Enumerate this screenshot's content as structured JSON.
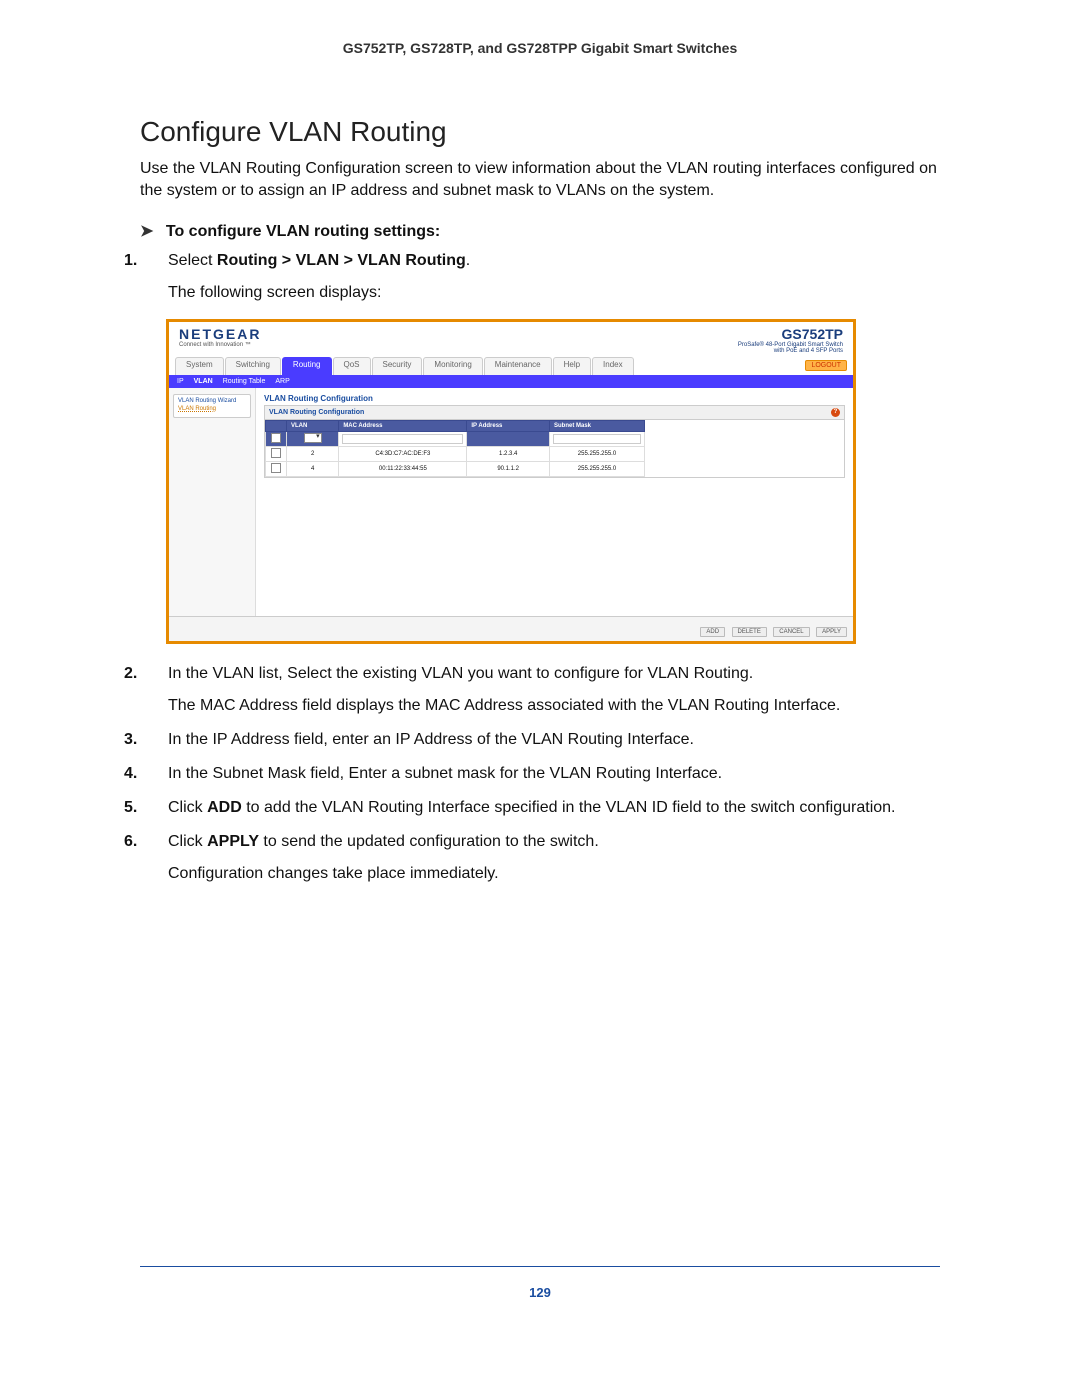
{
  "header": "GS752TP, GS728TP, and GS728TPP Gigabit Smart Switches",
  "section_title": "Configure VLAN Routing",
  "intro": "Use the VLAN Routing Configuration screen to view information about the VLAN routing interfaces configured on the system or to assign an IP address and subnet mask to VLANs on the system.",
  "procedure_heading": "To configure VLAN routing settings:",
  "steps": {
    "s1_prefix": "Select ",
    "s1_bold": "Routing > VLAN > VLAN Routing",
    "s1_suffix": ".",
    "s1_sub": "The following screen displays:",
    "s2": "In the VLAN list, Select the existing VLAN you want to configure for VLAN Routing.",
    "s2_sub": "The MAC Address field displays the MAC Address associated with the VLAN Routing Interface.",
    "s3": "In the IP Address field, enter an IP Address of the VLAN Routing Interface.",
    "s4": "In the Subnet Mask field, Enter a subnet mask for the VLAN Routing Interface.",
    "s5_prefix": "Click ",
    "s5_bold": "ADD",
    "s5_suffix": " to add the VLAN Routing Interface specified in the VLAN ID field to the switch configuration.",
    "s6_prefix": "Click ",
    "s6_bold": "APPLY",
    "s6_suffix": " to send the updated configuration to the switch.",
    "s6_sub": "Configuration changes take place immediately."
  },
  "ui": {
    "brand": "NETGEAR",
    "brand_sub": "Connect with Innovation ™",
    "model": "GS752TP",
    "model_sub1": "ProSafe® 48-Port Gigabit Smart Switch",
    "model_sub2": "with PoE and 4 SFP Ports",
    "tabs": [
      "System",
      "Switching",
      "Routing",
      "QoS",
      "Security",
      "Monitoring",
      "Maintenance",
      "Help",
      "Index"
    ],
    "logout": "LOGOUT",
    "subtabs": [
      "IP",
      "VLAN",
      "Routing Table",
      "ARP"
    ],
    "side_links": {
      "l1": "VLAN Routing Wizard",
      "l2": "VLAN Routing"
    },
    "panel_title": "VLAN Routing Configuration",
    "panel_sub": "VLAN Routing Configuration",
    "table_headers": {
      "h0": "",
      "h1": "VLAN",
      "h2": "MAC Address",
      "h3": "IP Address",
      "h4": "Subnet Mask"
    },
    "rows": [
      {
        "vlan": "2",
        "mac": "C4:3D:C7:AC:DE:F3",
        "ip": "1.2.3.4",
        "mask": "255.255.255.0"
      },
      {
        "vlan": "4",
        "mac": "00:11:22:33:44:55",
        "ip": "90.1.1.2",
        "mask": "255.255.255.0"
      }
    ],
    "buttons": {
      "add": "ADD",
      "delete": "DELETE",
      "cancel": "CANCEL",
      "apply": "APPLY"
    }
  },
  "page_number": "129"
}
